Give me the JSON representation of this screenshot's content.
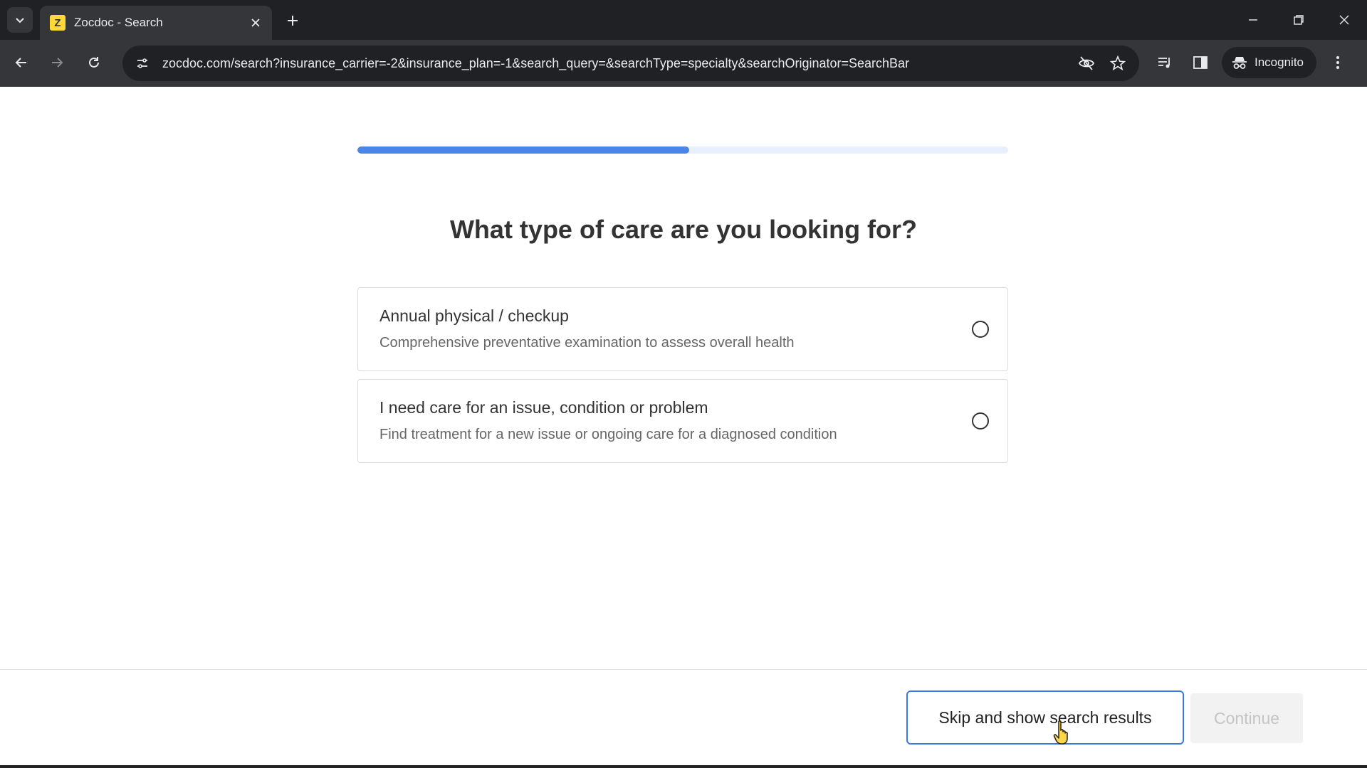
{
  "browser": {
    "tab_title": "Zocdoc - Search",
    "favicon_letter": "Z",
    "url": "zocdoc.com/search?insurance_carrier=-2&insurance_plan=-1&search_query=&searchType=specialty&searchOriginator=SearchBar",
    "incognito_label": "Incognito"
  },
  "progress": {
    "fraction": 0.51,
    "fill_color": "#4a86e8",
    "track_color": "#e8f0fe"
  },
  "question": "What type of care are you looking for?",
  "options": [
    {
      "title": "Annual physical / checkup",
      "description": "Comprehensive preventative examination to assess overall health"
    },
    {
      "title": "I need care for an issue, condition or problem",
      "description": "Find treatment for a new issue or ongoing care for a diagnosed condition"
    }
  ],
  "actions": {
    "skip_label": "Skip and show search results",
    "continue_label": "Continue"
  },
  "icons": [
    "tab-search-icon",
    "close-icon",
    "plus-icon",
    "minimize-icon",
    "restore-icon",
    "back-icon",
    "forward-icon",
    "reload-icon",
    "site-info-icon",
    "eye-slash-icon",
    "star-icon",
    "media-icon",
    "sidepanel-icon",
    "incognito-icon",
    "menu-icon",
    "pointer-cursor-icon"
  ]
}
